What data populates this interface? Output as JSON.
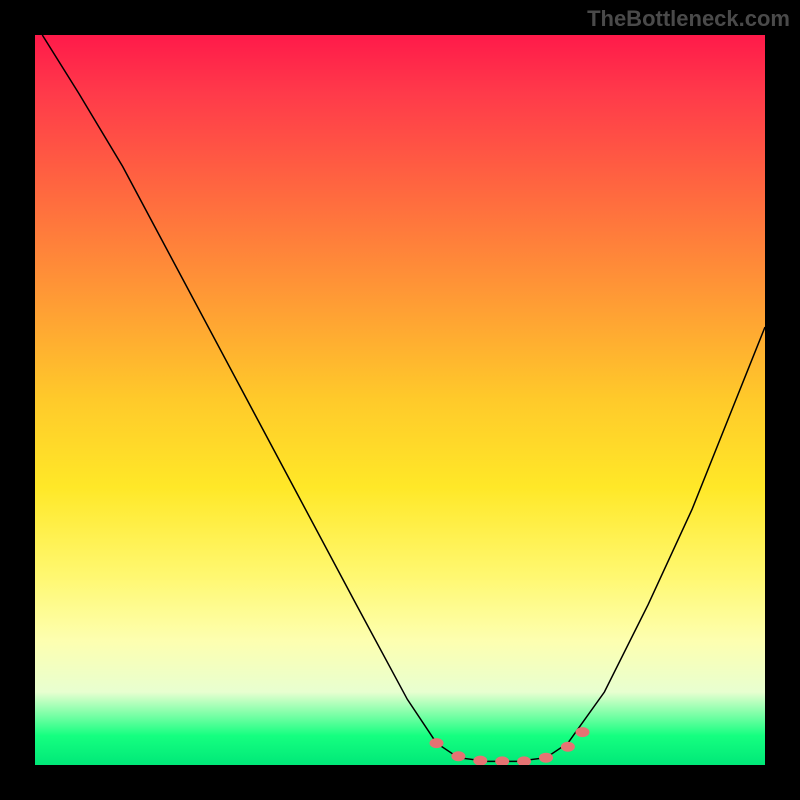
{
  "watermark": "TheBottleneck.com",
  "chart_data": {
    "type": "line",
    "title": "",
    "xlabel": "",
    "ylabel": "",
    "xlim": [
      0,
      100
    ],
    "ylim": [
      0,
      100
    ],
    "description": "Bottleneck curve on gradient background: red (top, high bottleneck) to green (bottom, optimal). Curve descends steeply from upper-left, reaches minimum in a flat valley around x≈60–70, then rises toward upper-right.",
    "curve_points": [
      {
        "x": 1,
        "y": 100
      },
      {
        "x": 6,
        "y": 92
      },
      {
        "x": 12,
        "y": 82
      },
      {
        "x": 20,
        "y": 67
      },
      {
        "x": 28,
        "y": 52
      },
      {
        "x": 36,
        "y": 37
      },
      {
        "x": 44,
        "y": 22
      },
      {
        "x": 51,
        "y": 9
      },
      {
        "x": 55,
        "y": 3
      },
      {
        "x": 58,
        "y": 1
      },
      {
        "x": 62,
        "y": 0.5
      },
      {
        "x": 66,
        "y": 0.5
      },
      {
        "x": 70,
        "y": 1
      },
      {
        "x": 73,
        "y": 3
      },
      {
        "x": 78,
        "y": 10
      },
      {
        "x": 84,
        "y": 22
      },
      {
        "x": 90,
        "y": 35
      },
      {
        "x": 96,
        "y": 50
      },
      {
        "x": 100,
        "y": 60
      }
    ],
    "marker_points": [
      {
        "x": 55,
        "y": 3
      },
      {
        "x": 58,
        "y": 1.2
      },
      {
        "x": 61,
        "y": 0.6
      },
      {
        "x": 64,
        "y": 0.5
      },
      {
        "x": 67,
        "y": 0.5
      },
      {
        "x": 70,
        "y": 1
      },
      {
        "x": 73,
        "y": 2.5
      },
      {
        "x": 75,
        "y": 4.5
      }
    ],
    "gradient_stops": [
      {
        "pos": 0,
        "color": "#ff1a4a"
      },
      {
        "pos": 50,
        "color": "#ffe828"
      },
      {
        "pos": 100,
        "color": "#00e878"
      }
    ]
  }
}
